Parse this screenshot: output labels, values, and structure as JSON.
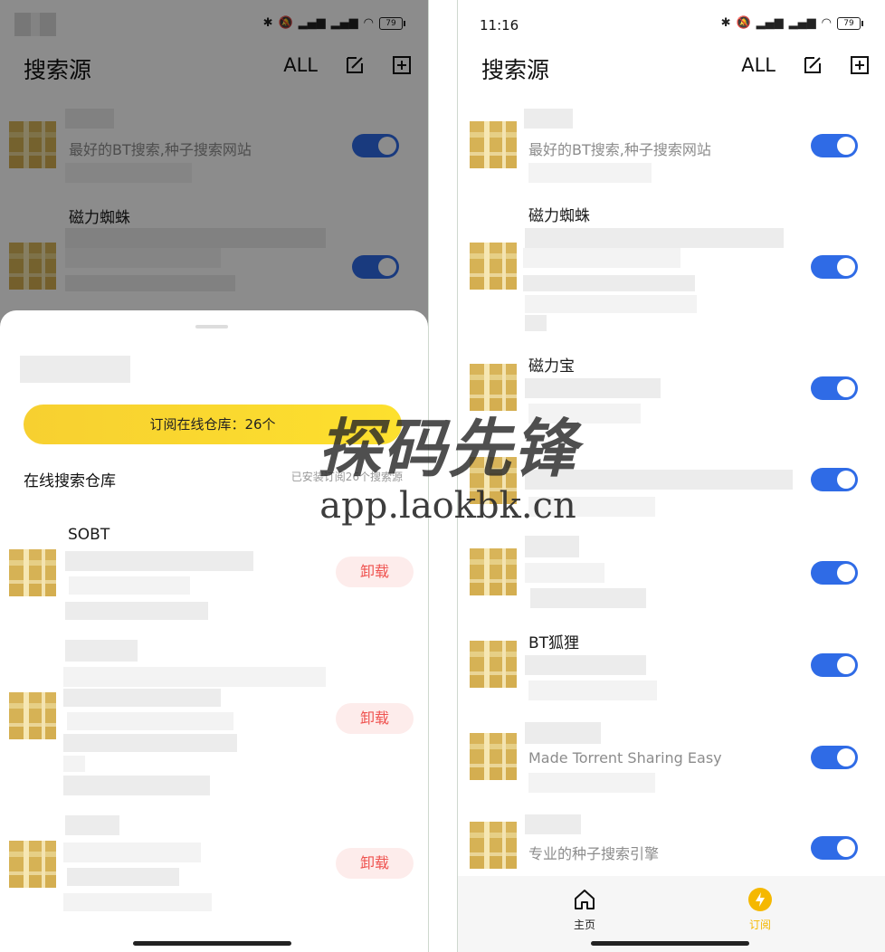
{
  "status_bar": {
    "time": "11:16",
    "battery": "79",
    "signal_labels": [
      "HD",
      "HD"
    ]
  },
  "header": {
    "title": "搜索源",
    "all_label": "ALL",
    "edit_icon": "edit-icon",
    "add_icon": "add-box-icon"
  },
  "sources_left": [
    {
      "desc": "最好的BT搜索,种子搜索网站",
      "enabled": true
    },
    {
      "name": "磁力蜘蛛",
      "enabled": true
    }
  ],
  "sheet": {
    "subscribe_button": "订阅在线仓库：26个",
    "repo_title": "在线搜索仓库",
    "repo_count": "已安装订阅26个搜索源",
    "items": [
      {
        "name": "SOBT",
        "action": "卸载"
      },
      {
        "action": "卸载"
      },
      {
        "action": "卸载"
      }
    ]
  },
  "sources_right": [
    {
      "desc": "最好的BT搜索,种子搜索网站",
      "enabled": true
    },
    {
      "name": "磁力蜘蛛",
      "enabled": true
    },
    {
      "name": "磁力宝",
      "enabled": true
    },
    {
      "enabled": true
    },
    {
      "enabled": true
    },
    {
      "name": "BT狐狸",
      "enabled": true
    },
    {
      "desc": "Made Torrent Sharing  Easy",
      "enabled": true
    },
    {
      "desc": "专业的种子搜索引擎",
      "enabled": true
    }
  ],
  "bottom_nav": {
    "items": [
      {
        "label": "主页",
        "icon": "home-icon"
      },
      {
        "label": "订阅",
        "icon": "lightning-icon"
      }
    ],
    "active": "订阅",
    "active_color": "#f5b800"
  },
  "watermark": {
    "title": "探码先锋",
    "url": "app.laokbk.cn"
  },
  "colors": {
    "toggle": "#2f6be6",
    "subscribe": "#f8d52f",
    "uninstall_text": "#ef5350"
  }
}
